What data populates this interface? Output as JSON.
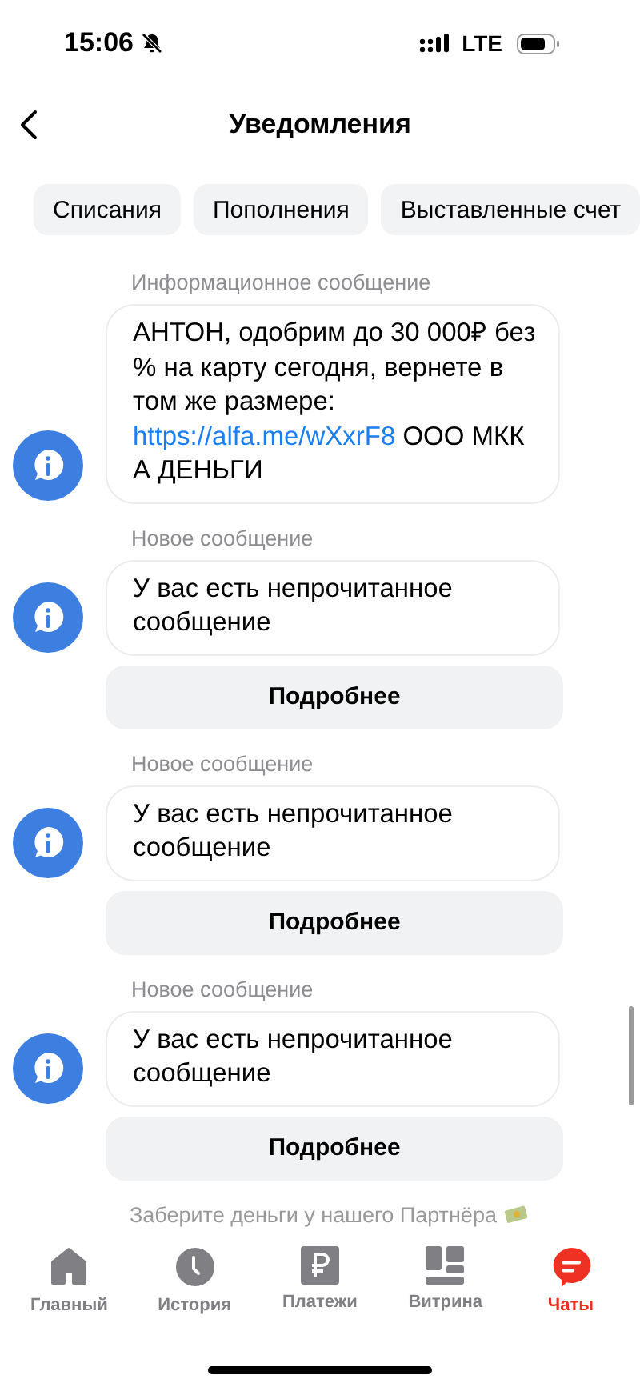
{
  "status_bar": {
    "time": "15:06",
    "network": "LTE"
  },
  "header": {
    "title": "Уведомления"
  },
  "chips": [
    {
      "label": "Списания",
      "selected": false
    },
    {
      "label": "Пополнения",
      "selected": false
    },
    {
      "label": "Выставленные счет",
      "selected": false
    }
  ],
  "messages": [
    {
      "label": "Информационное сообщение",
      "text": "АНТОН, одобрим до 30 000₽ без % на карту сегодня, вернете в том же размере: ",
      "link": "https://alfa.me/wXxrF8",
      "text_after": " ООО МКК А ДЕНЬГИ"
    },
    {
      "label": "Новое сообщение",
      "text": "У вас есть непрочитанное сообщение",
      "button": "Подробнее"
    },
    {
      "label": "Новое сообщение",
      "text": "У вас есть непрочитанное сообщение",
      "button": "Подробнее"
    },
    {
      "label": "Новое сообщение",
      "text": "У вас есть непрочитанное сообщение",
      "button": "Подробнее"
    }
  ],
  "next_label": "Заберите деньги у нашего Партнёра",
  "tab_bar": [
    {
      "label": "Главный",
      "kind": "home",
      "selected": false
    },
    {
      "label": "История",
      "kind": "history",
      "selected": false
    },
    {
      "label": "Платежи",
      "kind": "payments",
      "selected": false
    },
    {
      "label": "Витрина",
      "kind": "showcase",
      "selected": false
    },
    {
      "label": "Чаты",
      "kind": "chats",
      "selected": true
    }
  ]
}
